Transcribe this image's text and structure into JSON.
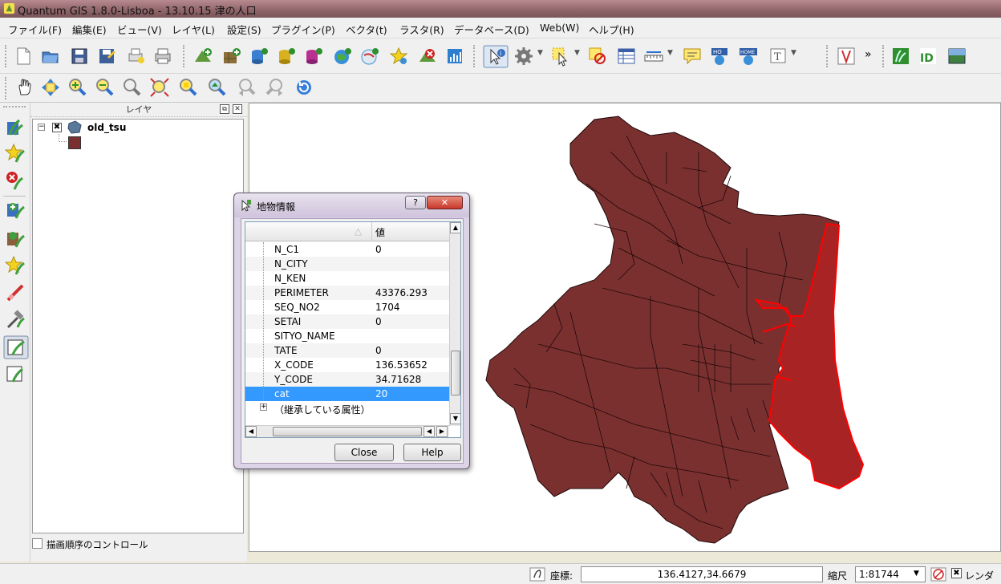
{
  "window": {
    "title": "Quantum GIS 1.8.0-Lisboa - 13.10.15 津の人口"
  },
  "menu": [
    "ファイル(F)",
    "編集(E)",
    "ビュー(V)",
    "レイヤ(L)",
    "設定(S)",
    "プラグイン(P)",
    "ベクタ(t)",
    "ラスタ(R)",
    "データベース(D)",
    "Web(W)",
    "ヘルプ(H)"
  ],
  "toolbar": {
    "overflow": "»"
  },
  "layers_panel": {
    "title": "レイヤ",
    "layer_name": "old_tsu",
    "render_order_label": "描画順序のコントロール"
  },
  "identify_dialog": {
    "title": "地物情報",
    "help_glyph": "?",
    "close_glyph": "✕",
    "value_header": "値",
    "rows": [
      {
        "key": "N_C1",
        "value": "0"
      },
      {
        "key": "N_CITY",
        "value": ""
      },
      {
        "key": "N_KEN",
        "value": ""
      },
      {
        "key": "PERIMETER",
        "value": "43376.293"
      },
      {
        "key": "SEQ_NO2",
        "value": "1704"
      },
      {
        "key": "SETAI",
        "value": "0"
      },
      {
        "key": "SITYO_NAME",
        "value": ""
      },
      {
        "key": "TATE",
        "value": "0"
      },
      {
        "key": "X_CODE",
        "value": "136.53652"
      },
      {
        "key": "Y_CODE",
        "value": "34.71628"
      },
      {
        "key": "cat",
        "value": "20"
      }
    ],
    "selected_row": "cat",
    "inherited_label": "（継承している属性）",
    "close_button": "Close",
    "help_button": "Help"
  },
  "status": {
    "coord_label": "座標:",
    "coord_value": "136.4127,34.6679",
    "scale_label": "縮尺",
    "scale_value": "1:81744",
    "render_label": "レンダ"
  },
  "colors": {
    "polygon_fill": "#7b3030",
    "selected_outline": "#ff0000",
    "selected_fill": "#a82424"
  }
}
